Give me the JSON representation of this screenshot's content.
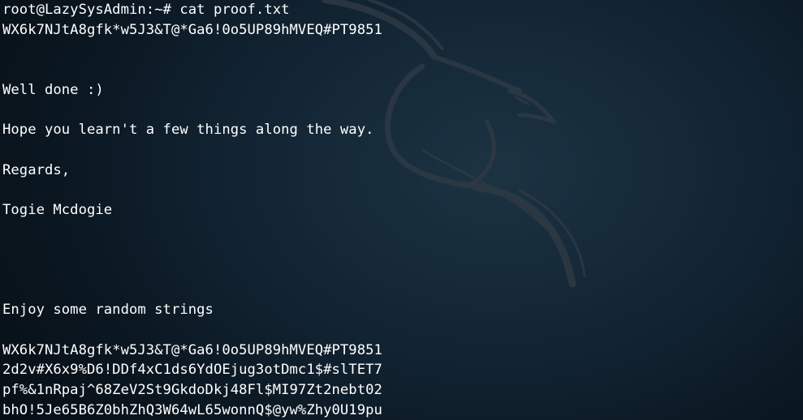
{
  "terminal": {
    "lines": [
      "root@LazySysAdmin:~# cat proof.txt",
      "WX6k7NJtA8gfk*w5J3&T@*Ga6!0o5UP89hMVEQ#PT9851",
      "",
      "",
      "Well done :)",
      "",
      "Hope you learn't a few things along the way.",
      "",
      "Regards,",
      "",
      "Togie Mcdogie",
      "",
      "",
      "",
      "",
      "Enjoy some random strings",
      "",
      "WX6k7NJtA8gfk*w5J3&T@*Ga6!0o5UP89hMVEQ#PT9851",
      "2d2v#X6x9%D6!DDf4xC1ds6YdOEjug3otDmc1$#slTET7",
      "pf%&1nRpaj^68ZeV2St9GkdoDkj48Fl$MI97Zt2nebt02",
      "bhO!5Je65B6Z0bhZhQ3W64wL65wonnQ$@yw%Zhy0U19pu"
    ]
  },
  "colors": {
    "text": "#ffffff",
    "background": "#0a1620",
    "wallpaper_logo": "#2a3540"
  },
  "icons": {
    "wallpaper": "kali-dragon-icon"
  }
}
